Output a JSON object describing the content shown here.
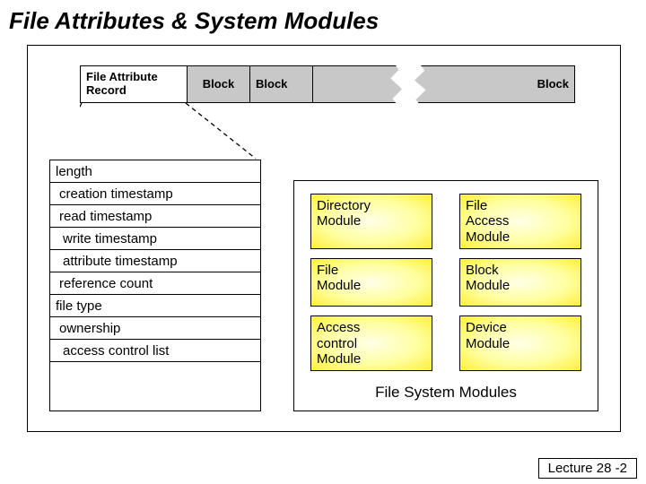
{
  "title": "File Attributes & System Modules",
  "record": {
    "first": "File Attribute\nRecord",
    "block": "Block"
  },
  "attributes": [
    "length",
    "creation timestamp",
    "read timestamp",
    "write timestamp",
    "attribute timestamp",
    "reference count",
    "file type",
    "ownership",
    "access control list"
  ],
  "modules": {
    "items": [
      "Directory\nModule",
      "File\nAccess\nModule",
      "File\nModule",
      "Block\nModule",
      "Access\ncontrol\nModule",
      "Device\nModule"
    ],
    "caption": "File System Modules"
  },
  "footer": "Lecture 28 -2"
}
